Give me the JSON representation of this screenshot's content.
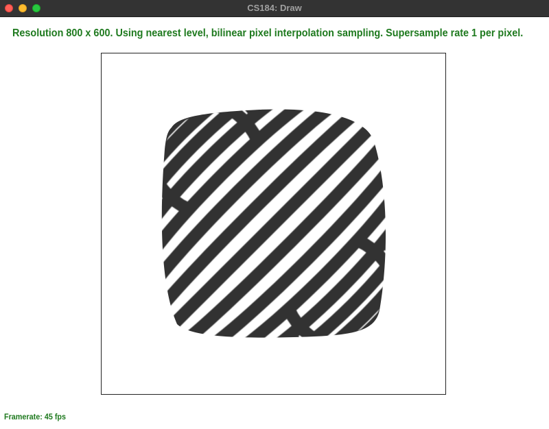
{
  "window": {
    "title": "CS184: Draw",
    "buttons": [
      "close",
      "minimize",
      "maximize"
    ]
  },
  "status": {
    "info_line": "Resolution 800 x 600. Using nearest level, bilinear pixel interpolation sampling. Supersample rate 1 per pixel.",
    "framerate": "Framerate: 45 fps"
  },
  "colors": {
    "status_text": "#1f7a1f",
    "stripe_dark": "#333333",
    "stripe_light": "#ffffff",
    "titlebar": "#333333"
  },
  "canvas": {
    "content": "warped-stripe-texture"
  }
}
